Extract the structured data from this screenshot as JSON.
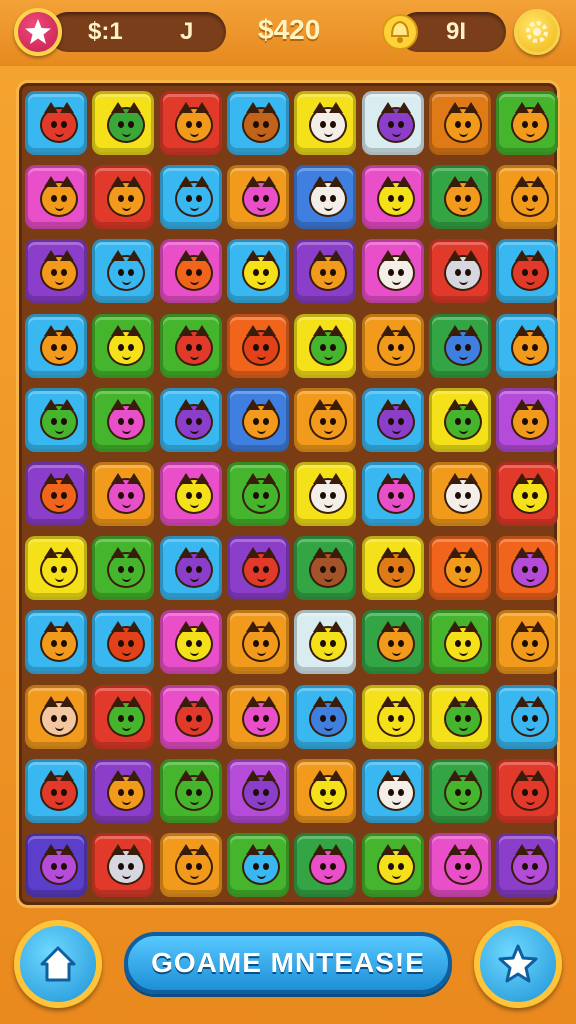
{
  "hud": {
    "left_pill_value_a": "$:1",
    "left_pill_value_b": "J",
    "coins": "$420",
    "right_pill_value": "9I"
  },
  "footer": {
    "main_button_label": "GOAME MNTEAS!E"
  },
  "colors": {
    "board_frame": "#7a3c14",
    "button_blue": "#1d93d6",
    "accent_gold": "#ffc53a"
  },
  "board": {
    "rows": 11,
    "cols": 8,
    "tiles": [
      [
        "#39b7f0",
        "#f4e11a",
        "#e23a2a",
        "#39b7f0",
        "#f4e11a",
        "#d9ecef",
        "#e07a16",
        "#44b52c"
      ],
      [
        "#e94fc8",
        "#e23a2a",
        "#39b7f0",
        "#f29a1c",
        "#3f7fe0",
        "#e94fc8",
        "#33a544",
        "#f29a1c"
      ],
      [
        "#8b3ec9",
        "#39b7f0",
        "#e94fc8",
        "#39b7f0",
        "#8b3ec9",
        "#e94fc8",
        "#e23a2a",
        "#39b7f0"
      ],
      [
        "#39b7f0",
        "#44b52c",
        "#44b52c",
        "#f0641c",
        "#f4e11a",
        "#f29a1c",
        "#33a544",
        "#39b7f0"
      ],
      [
        "#39b7f0",
        "#44b52c",
        "#39b7f0",
        "#3f7fe0",
        "#f29a1c",
        "#39b7f0",
        "#f4e11a",
        "#b54bd9"
      ],
      [
        "#8b3ec9",
        "#f29a1c",
        "#e94fc8",
        "#44b52c",
        "#f4e11a",
        "#39b7f0",
        "#f29a1c",
        "#e23a2a"
      ],
      [
        "#f4e11a",
        "#44b52c",
        "#39b7f0",
        "#8b3ec9",
        "#33a544",
        "#f4e11a",
        "#f0641c",
        "#f0641c"
      ],
      [
        "#39b7f0",
        "#39b7f0",
        "#e94fc8",
        "#f29a1c",
        "#d9ecef",
        "#33a544",
        "#44b52c",
        "#f29a1c"
      ],
      [
        "#f29a1c",
        "#e23a2a",
        "#e94fc8",
        "#f29a1c",
        "#39b7f0",
        "#f4e11a",
        "#f4e11a",
        "#39b7f0"
      ],
      [
        "#39b7f0",
        "#8b3ec9",
        "#44b52c",
        "#b54bd9",
        "#f29a1c",
        "#39b7f0",
        "#33a544",
        "#e23a2a"
      ],
      [
        "#5b3ec9",
        "#e23a2a",
        "#f29a1c",
        "#44b52c",
        "#33a544",
        "#44b52c",
        "#e94fc8",
        "#8b3ec9"
      ]
    ],
    "icon_colors": [
      [
        "#e23a2a",
        "#3aa838",
        "#f29a1c",
        "#c2631c",
        "#f3efe8",
        "#8b3ec9",
        "#f29a1c",
        "#f29a1c"
      ],
      [
        "#f29a1c",
        "#f29a1c",
        "#39b7f0",
        "#e94fc8",
        "#f3efe8",
        "#f4e11a",
        "#f29a1c",
        "#f29a1c"
      ],
      [
        "#f29a1c",
        "#39b7f0",
        "#f0641c",
        "#f4e11a",
        "#f29a1c",
        "#f3efe8",
        "#d7d7e0",
        "#e23a2a"
      ],
      [
        "#f29a1c",
        "#f4e11a",
        "#e23a2a",
        "#e2411a",
        "#44b52c",
        "#f29a1c",
        "#3f7fe0",
        "#f29a1c"
      ],
      [
        "#44b52c",
        "#e94fc8",
        "#8b3ec9",
        "#f29a1c",
        "#f29a1c",
        "#8b3ec9",
        "#44b52c",
        "#f29a1c"
      ],
      [
        "#f0641c",
        "#e94fc8",
        "#f4e11a",
        "#44b52c",
        "#f3efe8",
        "#e94fc8",
        "#f3efe8",
        "#f4e11a"
      ],
      [
        "#f4e11a",
        "#44b52c",
        "#8b3ec9",
        "#e23a2a",
        "#a4522a",
        "#e07a16",
        "#f29a1c",
        "#b54bd9"
      ],
      [
        "#f29a1c",
        "#e2411a",
        "#f4e11a",
        "#f29a1c",
        "#f4e11a",
        "#f29a1c",
        "#f4e11a",
        "#f29a1c"
      ],
      [
        "#f3c8a0",
        "#44b52c",
        "#e23a2a",
        "#e94fc8",
        "#3f7fe0",
        "#f4e11a",
        "#44b52c",
        "#39b7f0"
      ],
      [
        "#e23a2a",
        "#f29a1c",
        "#44b52c",
        "#8b3ec9",
        "#f4e11a",
        "#f3efe8",
        "#44b52c",
        "#e23a2a"
      ],
      [
        "#b54bd9",
        "#d7d7e0",
        "#f29a1c",
        "#39b7f0",
        "#e94fc8",
        "#f4e11a",
        "#e94fc8",
        "#b54bd9"
      ]
    ]
  }
}
